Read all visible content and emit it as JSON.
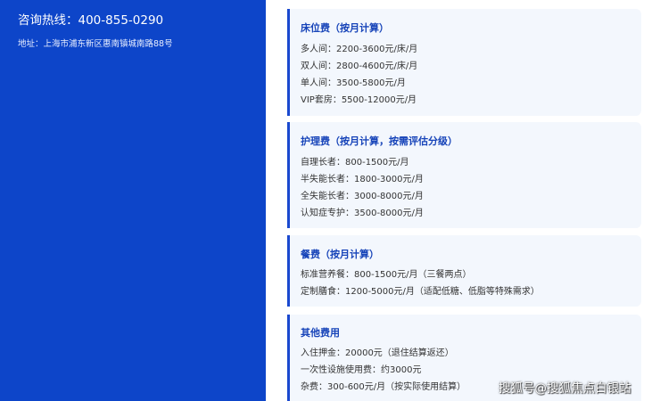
{
  "left_panel": {
    "hotline": "咨询热线：400-855-0290",
    "address": "地址：上海市浦东新区惠南镇城南路88号"
  },
  "cards": [
    {
      "title": "床位费（按月计算）",
      "lines": [
        "多人间：2200-3600元/床/月",
        "双人间：2800-4600元/床/月",
        "单人间：3500-5800元/月",
        "VIP套房：5500-12000元/月"
      ]
    },
    {
      "title": "护理费（按月计算，按需评估分级）",
      "lines": [
        "自理长者：800-1500元/月",
        "半失能长者：1800-3000元/月",
        "全失能长者：3000-8000元/月",
        "认知症专护：3500-8000元/月"
      ]
    },
    {
      "title": "餐费（按月计算）",
      "lines": [
        "标准营养餐：800-1500元/月（三餐两点）",
        "定制膳食：1200-5000元/月（适配低糖、低脂等特殊需求）"
      ]
    },
    {
      "title": "其他费用",
      "lines": [
        "入住押金：20000元（退住结算返还）",
        "一次性设施使用费：约3000元",
        "杂费：300-600元/月（按实际使用结算）"
      ]
    }
  ],
  "watermark": "搜狐号@搜狐焦点白银站"
}
